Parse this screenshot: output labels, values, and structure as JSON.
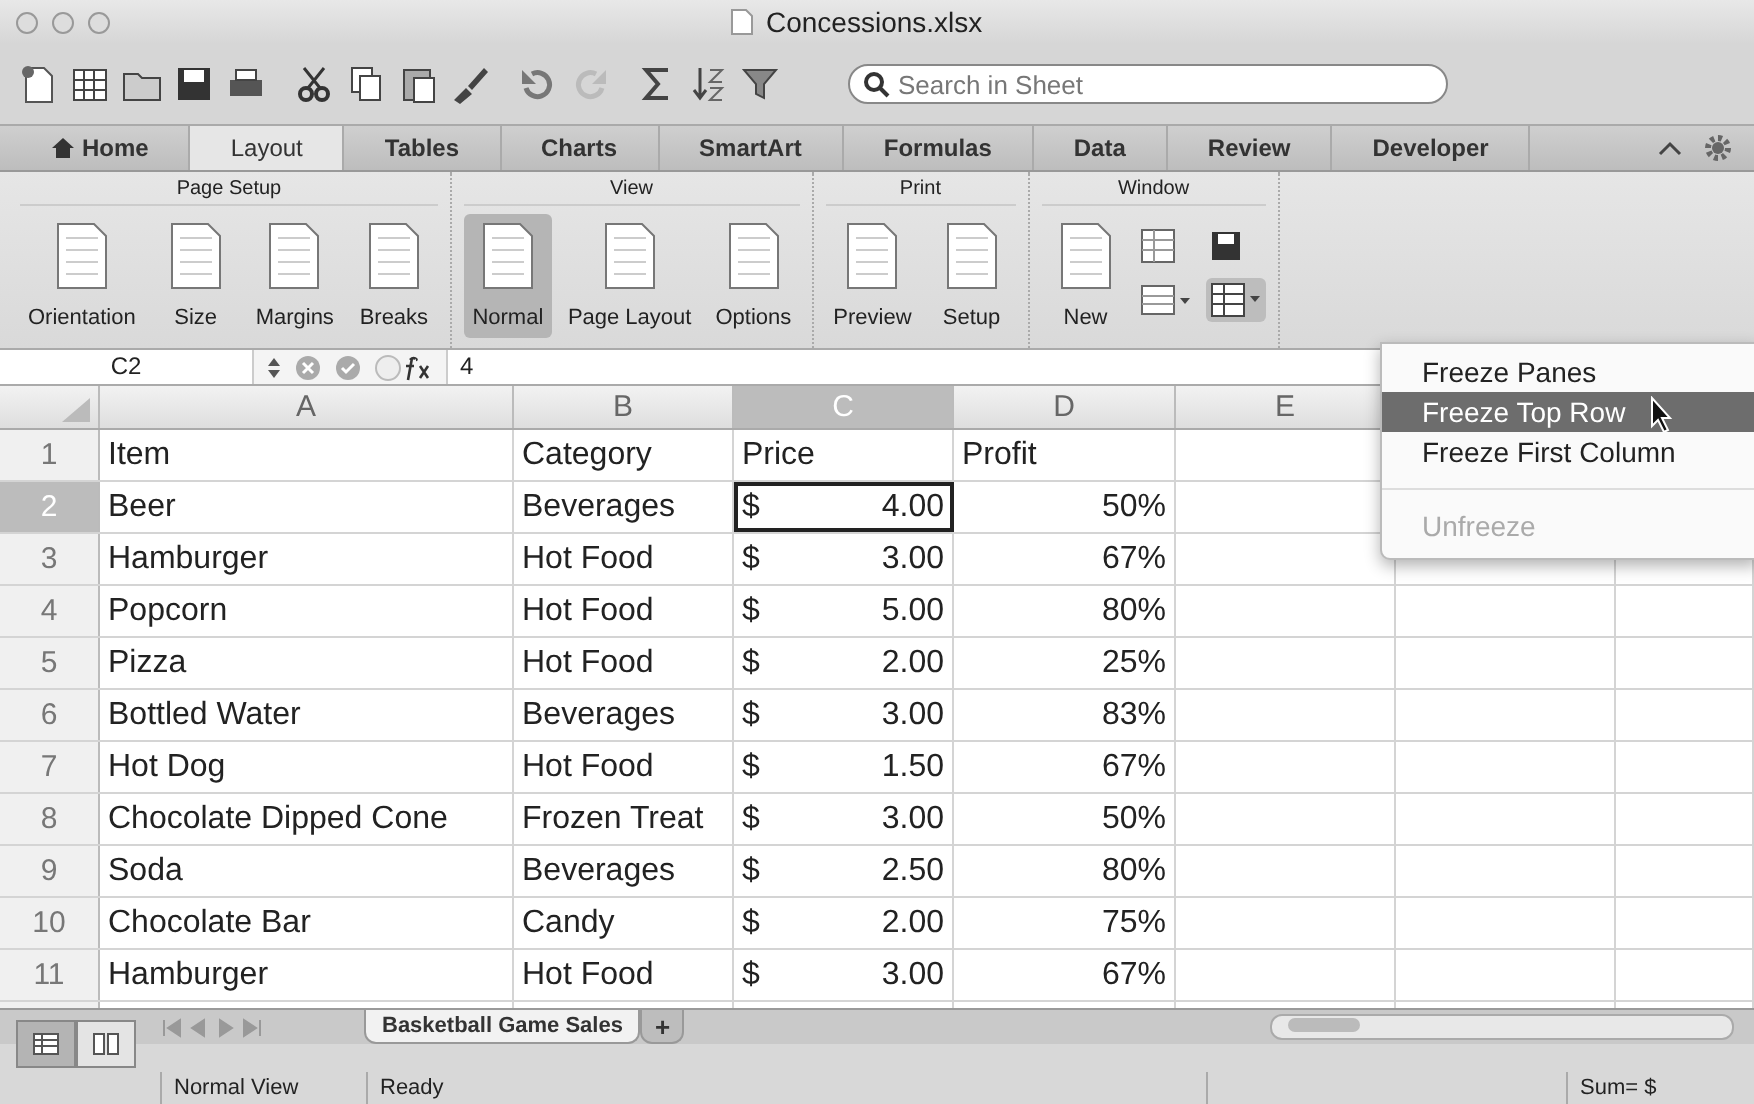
{
  "window": {
    "title": "Concessions.xlsx"
  },
  "search": {
    "placeholder": "Search in Sheet"
  },
  "tabs": [
    {
      "label": "Home",
      "selected": false
    },
    {
      "label": "Layout",
      "selected": true
    },
    {
      "label": "Tables",
      "selected": false
    },
    {
      "label": "Charts",
      "selected": false
    },
    {
      "label": "SmartArt",
      "selected": false
    },
    {
      "label": "Formulas",
      "selected": false
    },
    {
      "label": "Data",
      "selected": false
    },
    {
      "label": "Review",
      "selected": false
    },
    {
      "label": "Developer",
      "selected": false
    }
  ],
  "ribbon": [
    {
      "title": "Page Setup",
      "buttons": [
        {
          "label": "Orientation",
          "selected": false
        },
        {
          "label": "Size",
          "selected": false
        },
        {
          "label": "Margins",
          "selected": false
        },
        {
          "label": "Breaks",
          "selected": false
        }
      ]
    },
    {
      "title": "View",
      "buttons": [
        {
          "label": "Normal",
          "selected": true
        },
        {
          "label": "Page Layout",
          "selected": false
        },
        {
          "label": "Options",
          "selected": false
        }
      ]
    },
    {
      "title": "Print",
      "buttons": [
        {
          "label": "Preview",
          "selected": false
        },
        {
          "label": "Setup",
          "selected": false
        }
      ]
    },
    {
      "title": "Window",
      "buttons": [
        {
          "label": "New",
          "selected": false
        }
      ]
    }
  ],
  "formula_bar": {
    "cell": "C2",
    "formula": "4"
  },
  "sheet": {
    "columns": [
      {
        "label": "A",
        "selected": false
      },
      {
        "label": "B",
        "selected": false
      },
      {
        "label": "C",
        "selected": true
      },
      {
        "label": "D",
        "selected": false
      },
      {
        "label": "E",
        "selected": false
      }
    ],
    "header_row": {
      "number": "1",
      "cells": [
        "Item",
        "Category",
        "Price",
        "Profit"
      ]
    },
    "rows": [
      {
        "number": "2",
        "selected": true,
        "item": "Beer",
        "category": "Beverages",
        "currency": "$",
        "price": "4.00",
        "profit": "50%"
      },
      {
        "number": "3",
        "selected": false,
        "item": "Hamburger",
        "category": "Hot Food",
        "currency": "$",
        "price": "3.00",
        "profit": "67%"
      },
      {
        "number": "4",
        "selected": false,
        "item": "Popcorn",
        "category": "Hot Food",
        "currency": "$",
        "price": "5.00",
        "profit": "80%"
      },
      {
        "number": "5",
        "selected": false,
        "item": "Pizza",
        "category": "Hot Food",
        "currency": "$",
        "price": "2.00",
        "profit": "25%"
      },
      {
        "number": "6",
        "selected": false,
        "item": "Bottled Water",
        "category": "Beverages",
        "currency": "$",
        "price": "3.00",
        "profit": "83%"
      },
      {
        "number": "7",
        "selected": false,
        "item": "Hot Dog",
        "category": "Hot Food",
        "currency": "$",
        "price": "1.50",
        "profit": "67%"
      },
      {
        "number": "8",
        "selected": false,
        "item": "Chocolate Dipped Cone",
        "category": "Frozen Treat",
        "currency": "$",
        "price": "3.00",
        "profit": "50%"
      },
      {
        "number": "9",
        "selected": false,
        "item": "Soda",
        "category": "Beverages",
        "currency": "$",
        "price": "2.50",
        "profit": "80%"
      },
      {
        "number": "10",
        "selected": false,
        "item": "Chocolate Bar",
        "category": "Candy",
        "currency": "$",
        "price": "2.00",
        "profit": "75%"
      },
      {
        "number": "11",
        "selected": false,
        "item": "Hamburger",
        "category": "Hot Food",
        "currency": "$",
        "price": "3.00",
        "profit": "67%"
      }
    ]
  },
  "menu": {
    "items": [
      {
        "label": "Freeze Panes",
        "selected": false,
        "disabled": false,
        "separator_before": false
      },
      {
        "label": "Freeze Top Row",
        "selected": true,
        "disabled": false,
        "separator_before": false
      },
      {
        "label": "Freeze First Column",
        "selected": false,
        "disabled": false,
        "separator_before": false
      },
      {
        "label": "Unfreeze",
        "selected": false,
        "disabled": true,
        "separator_before": true
      }
    ]
  },
  "sheet_tabs": [
    {
      "label": "Basketball Game Sales",
      "selected": true
    },
    {
      "label": "+",
      "selected": false
    }
  ],
  "status_bar": {
    "view": "Normal View",
    "state": "Ready",
    "sum": "Sum= $"
  }
}
